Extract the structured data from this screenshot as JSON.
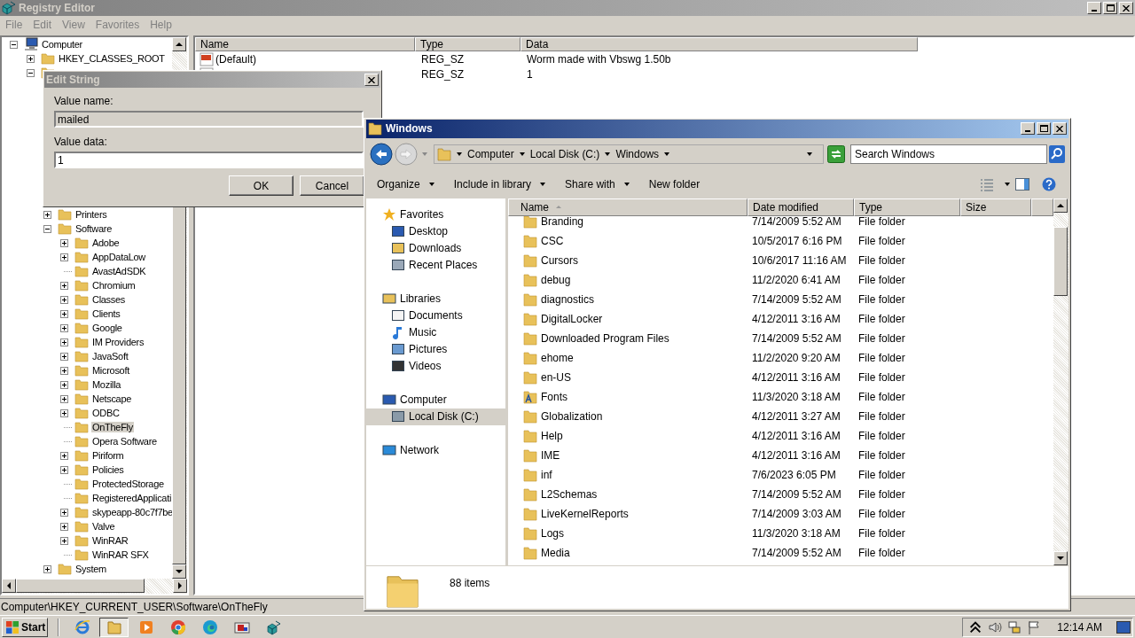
{
  "registry_editor": {
    "title": "Registry Editor",
    "menu": [
      "File",
      "Edit",
      "View",
      "Favorites",
      "Help"
    ],
    "tree": [
      {
        "label": "Computer",
        "expanded": true,
        "selected": false,
        "children": [
          {
            "label": "HKEY_CLASSES_ROOT",
            "expanded": false,
            "selected": false
          },
          {
            "expanded": true,
            "children": [
              {
                "label": "Printers",
                "expanded": false,
                "selected": false
              },
              {
                "label": "Software",
                "expanded": true,
                "selected": false,
                "children": [
                  {
                    "label": "Adobe",
                    "expanded": false,
                    "selected": false
                  },
                  {
                    "label": "AppDataLow",
                    "expanded": false,
                    "selected": false
                  },
                  {
                    "label": "AvastAdSDK",
                    "selected": false
                  },
                  {
                    "label": "Chromium",
                    "expanded": false,
                    "selected": false
                  },
                  {
                    "label": "Classes",
                    "expanded": false,
                    "selected": false
                  },
                  {
                    "label": "Clients",
                    "expanded": false,
                    "selected": false
                  },
                  {
                    "label": "Google",
                    "expanded": false,
                    "selected": false
                  },
                  {
                    "label": "IM Providers",
                    "expanded": false,
                    "selected": false
                  },
                  {
                    "label": "JavaSoft",
                    "expanded": false,
                    "selected": false
                  },
                  {
                    "label": "Microsoft",
                    "expanded": false,
                    "selected": false
                  },
                  {
                    "label": "Mozilla",
                    "expanded": false,
                    "selected": false
                  },
                  {
                    "label": "Netscape",
                    "expanded": false,
                    "selected": false
                  },
                  {
                    "label": "ODBC",
                    "expanded": false,
                    "selected": false
                  },
                  {
                    "label": "OnTheFly",
                    "selected": true
                  },
                  {
                    "label": "Opera Software",
                    "selected": false
                  },
                  {
                    "label": "Piriform",
                    "expanded": false,
                    "selected": false
                  },
                  {
                    "label": "Policies",
                    "expanded": false,
                    "selected": false
                  },
                  {
                    "label": "ProtectedStorage",
                    "selected": false
                  },
                  {
                    "label": "RegisteredApplicati",
                    "selected": false
                  },
                  {
                    "label": "skypeapp-80c7f7be",
                    "expanded": false,
                    "selected": false
                  },
                  {
                    "label": "Valve",
                    "expanded": false,
                    "selected": false
                  },
                  {
                    "label": "WinRAR",
                    "expanded": false,
                    "selected": false
                  },
                  {
                    "label": "WinRAR SFX",
                    "selected": false
                  }
                ]
              },
              {
                "label": "System",
                "expanded": false,
                "selected": false
              }
            ]
          }
        ]
      }
    ],
    "values": {
      "columns": [
        "Name",
        "Type",
        "Data"
      ],
      "rows": [
        {
          "name": "(Default)",
          "type": "REG_SZ",
          "data": "Worm made with Vbswg 1.50b"
        },
        {
          "type": "REG_SZ",
          "data": "1"
        }
      ]
    },
    "status_bar": "Computer\\HKEY_CURRENT_USER\\Software\\OnTheFly"
  },
  "edit_string_dialog": {
    "title": "Edit String",
    "value_name_label": "Value name:",
    "value_name": "mailed",
    "value_data_label": "Value data:",
    "value_data": "1",
    "buttons": [
      "OK",
      "Cancel"
    ]
  },
  "explorer": {
    "title": "Windows",
    "breadcrumbs": [
      "Computer",
      "Local Disk (C:)",
      "Windows"
    ],
    "search": {
      "placeholder": "Search Windows"
    },
    "toolbar": [
      {
        "label": "Organize",
        "dropdown": true
      },
      {
        "label": "Include in library",
        "dropdown": true
      },
      {
        "label": "Share with",
        "dropdown": true
      },
      {
        "label": "New folder",
        "dropdown": false
      }
    ],
    "nav": [
      {
        "label": "Favorites",
        "kind": "star",
        "selected": false,
        "children": [
          {
            "label": "Desktop",
            "kind": "desktop",
            "selected": false
          },
          {
            "label": "Downloads",
            "kind": "downloads",
            "selected": false
          },
          {
            "label": "Recent Places",
            "kind": "recent",
            "selected": false
          }
        ]
      },
      {
        "label": "Libraries",
        "kind": "library",
        "selected": false,
        "children": [
          {
            "label": "Documents",
            "kind": "documents",
            "selected": false
          },
          {
            "label": "Music",
            "kind": "music",
            "selected": false
          },
          {
            "label": "Pictures",
            "kind": "pictures",
            "selected": false
          },
          {
            "label": "Videos",
            "kind": "videos",
            "selected": false
          }
        ]
      },
      {
        "label": "Computer",
        "kind": "computer",
        "selected": false,
        "children": [
          {
            "label": "Local Disk (C:)",
            "kind": "disk",
            "selected": true
          }
        ]
      },
      {
        "label": "Network",
        "kind": "network",
        "selected": false
      }
    ],
    "columns": [
      {
        "label": "Name",
        "sorted": true
      },
      {
        "label": "Date modified",
        "sorted": false
      },
      {
        "label": "Type",
        "sorted": false
      },
      {
        "label": "Size",
        "sorted": false
      }
    ],
    "files": [
      {
        "name": "Branding",
        "date": "7/14/2009 5:52 AM",
        "type": "File folder",
        "kind": "folder"
      },
      {
        "name": "CSC",
        "date": "10/5/2017 6:16 PM",
        "type": "File folder",
        "kind": "folder"
      },
      {
        "name": "Cursors",
        "date": "10/6/2017 11:16 AM",
        "type": "File folder",
        "kind": "folder"
      },
      {
        "name": "debug",
        "date": "11/2/2020 6:41 AM",
        "type": "File folder",
        "kind": "folder"
      },
      {
        "name": "diagnostics",
        "date": "7/14/2009 5:52 AM",
        "type": "File folder",
        "kind": "folder"
      },
      {
        "name": "DigitalLocker",
        "date": "4/12/2011 3:16 AM",
        "type": "File folder",
        "kind": "folder"
      },
      {
        "name": "Downloaded Program Files",
        "date": "7/14/2009 5:52 AM",
        "type": "File folder",
        "kind": "folder"
      },
      {
        "name": "ehome",
        "date": "11/2/2020 9:20 AM",
        "type": "File folder",
        "kind": "folder"
      },
      {
        "name": "en-US",
        "date": "4/12/2011 3:16 AM",
        "type": "File folder",
        "kind": "folder"
      },
      {
        "name": "Fonts",
        "date": "11/3/2020 3:18 AM",
        "type": "File folder",
        "kind": "fonts"
      },
      {
        "name": "Globalization",
        "date": "4/12/2011 3:27 AM",
        "type": "File folder",
        "kind": "folder"
      },
      {
        "name": "Help",
        "date": "4/12/2011 3:16 AM",
        "type": "File folder",
        "kind": "folder"
      },
      {
        "name": "IME",
        "date": "4/12/2011 3:16 AM",
        "type": "File folder",
        "kind": "folder"
      },
      {
        "name": "inf",
        "date": "7/6/2023 6:05 PM",
        "type": "File folder",
        "kind": "folder"
      },
      {
        "name": "L2Schemas",
        "date": "7/14/2009 5:52 AM",
        "type": "File folder",
        "kind": "folder"
      },
      {
        "name": "LiveKernelReports",
        "date": "7/14/2009 3:03 AM",
        "type": "File folder",
        "kind": "folder"
      },
      {
        "name": "Logs",
        "date": "11/3/2020 3:18 AM",
        "type": "File folder",
        "kind": "folder"
      },
      {
        "name": "Media",
        "date": "7/14/2009 5:52 AM",
        "type": "File folder",
        "kind": "folder"
      }
    ],
    "status": "88 items"
  },
  "taskbar": {
    "start": "Start",
    "apps": [
      {
        "kind": "ie",
        "active": false
      },
      {
        "kind": "explorer",
        "active": true
      },
      {
        "kind": "media",
        "active": false
      },
      {
        "kind": "chrome",
        "active": false
      },
      {
        "kind": "edge",
        "active": false
      },
      {
        "kind": "app",
        "active": false
      },
      {
        "kind": "regedit",
        "active": false
      }
    ],
    "clock": "12:14 AM"
  }
}
